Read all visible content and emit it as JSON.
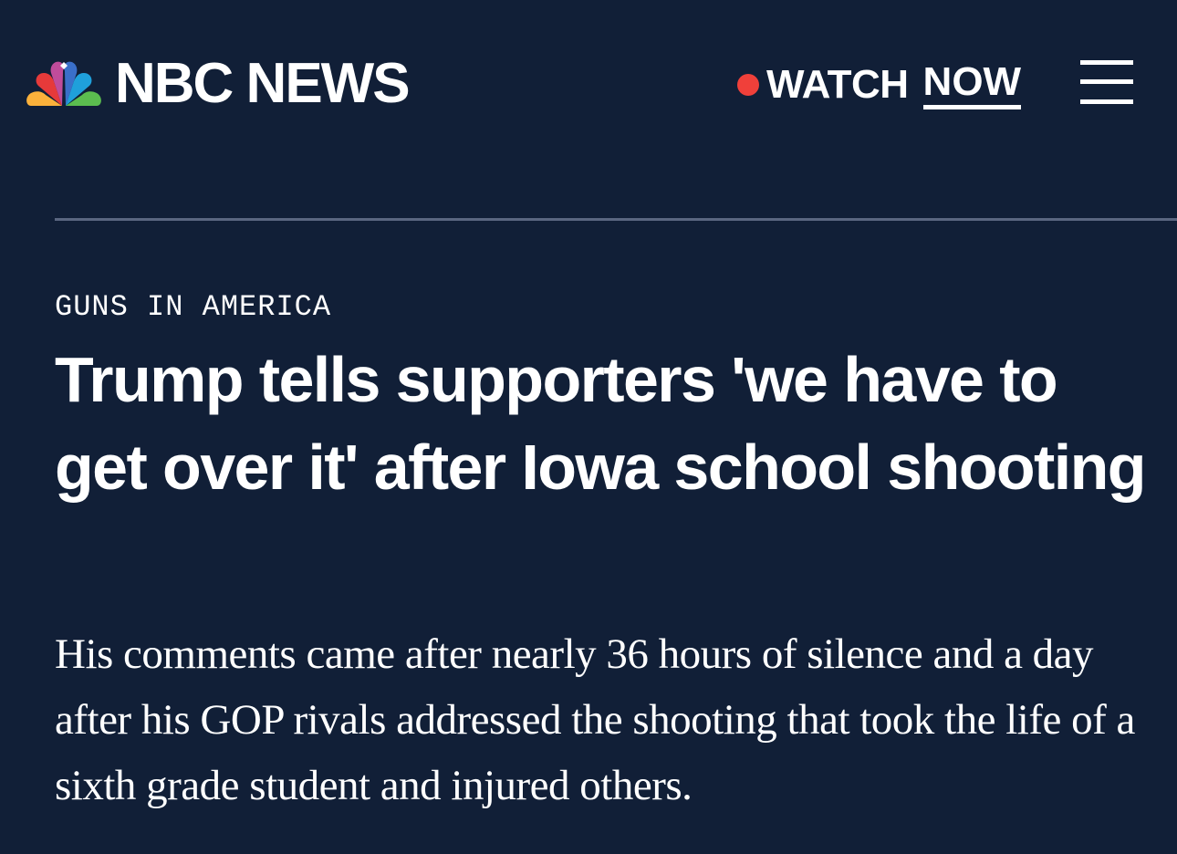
{
  "header": {
    "brand": "NBC NEWS",
    "logo_icon": "nbc-peacock-icon",
    "watch_label": "WATCH",
    "watch_now_label": "NOW",
    "menu_icon": "hamburger-menu-icon",
    "colors": {
      "background": "#111f37",
      "live_dot": "#f0403a",
      "text": "#ffffff",
      "divider": "#5a6680"
    }
  },
  "article": {
    "kicker": "GUNS IN AMERICA",
    "headline": "Trump tells supporters 'we have to get over it' after Iowa school shooting",
    "dek": "His comments came after nearly 36 hours of silence and a day after his GOP rivals addressed the shooting that took the life of a sixth grade student and injured others."
  }
}
